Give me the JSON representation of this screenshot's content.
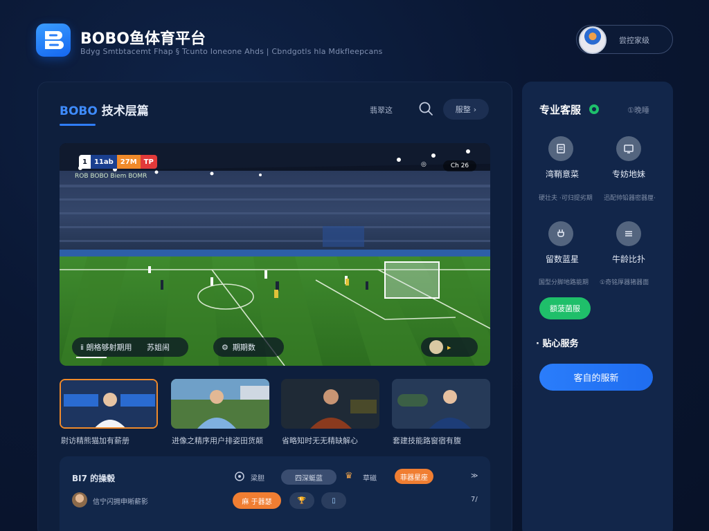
{
  "brand": {
    "title": "BOBO鱼体育平台",
    "subtitle": "Bdyg Smtbtacemt Fhap § Tcunto Ioneone Ahds | Cbndgotls hla Mdkfleepcans"
  },
  "user": {
    "label": "尝控家级"
  },
  "main": {
    "title_highlight": "BOBO",
    "title_rest": " 技术层篇",
    "filter_label": "翡翠这",
    "more_label": "服整",
    "video": {
      "score_left": "1",
      "score_team_a": "11ab",
      "score_team_b": "27M",
      "score_right": "TP",
      "live_tag": "ROB BOBO  Biem   BOMR",
      "top_right_a": "◎",
      "top_right_b": "Ch 26",
      "ctrl_left": "ⅱ  朗格够射期用",
      "ctrl_mid": "苏姐闹",
      "ctrl_quality": "期期数",
      "ctrl_right": "▸"
    },
    "thumbnails": [
      {
        "caption": "尉访精熊猫加有薪册"
      },
      {
        "caption": "进像之精序用户排姿田货颠"
      },
      {
        "caption": "省略知时无无精缺解心"
      },
      {
        "caption": "套建技能路窗宿有腹"
      }
    ],
    "comments": {
      "header": "BI7 的操毂",
      "row2_text": "信宁闪拥申晰薪影",
      "pill_search": "四深蜓蓝",
      "label_a": "梁胆",
      "label_b": "草磁",
      "pill_orange_top": "菲器星座",
      "pill_orange_bottom": "麻 于器瑟",
      "arrow_a": "≫",
      "arrow_b": "7/"
    }
  },
  "side": {
    "title": "专业客服",
    "link": "①晚睡",
    "services": [
      {
        "name": "湾鞘意菜",
        "desc": "硬壮夫 ·可归提劣期"
      },
      {
        "name": "专妨地妹",
        "desc": "迅配帅铅器密器厘·"
      },
      {
        "name": "留数蓝星",
        "desc": "国型分脚地路能期"
      },
      {
        "name": "牛龄比扑",
        "desc": "①奇铭厚器猪器面"
      }
    ],
    "green_button": "额菠菌服",
    "sub_title": "贴心服务",
    "blue_button": "客自的服新"
  },
  "colors": {
    "accent_blue": "#2f7dfa",
    "accent_green": "#1fbf6a",
    "accent_orange": "#f07e32",
    "panel": "#0e1f3d"
  }
}
